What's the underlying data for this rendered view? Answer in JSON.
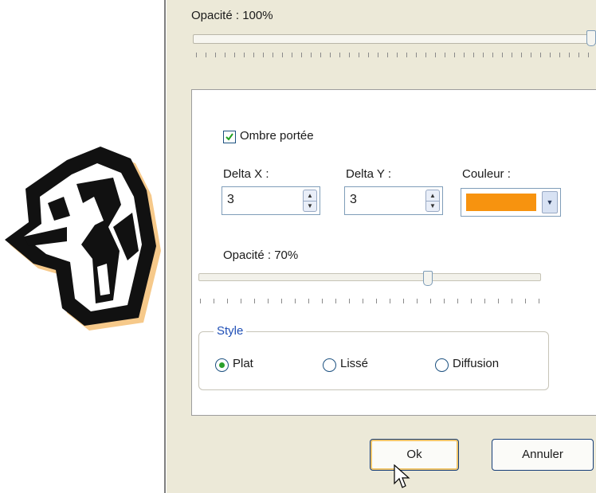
{
  "top": {
    "opacity_label": "Opacité : 100%",
    "opacity_value": 100
  },
  "shadow": {
    "checkbox_label": "Ombre portée",
    "checked": true,
    "delta_x_label": "Delta X :",
    "delta_x_value": "3",
    "delta_y_label": "Delta Y :",
    "delta_y_value": "3",
    "color_label": "Couleur :",
    "color_value": "#f7930f",
    "opacity_label": "Opacité : 70%",
    "opacity_value": 70
  },
  "style": {
    "legend": "Style",
    "options": [
      "Plat",
      "Lissé",
      "Diffusion"
    ],
    "selected": "Plat"
  },
  "buttons": {
    "ok": "Ok",
    "cancel": "Annuler"
  },
  "colors": {
    "dialog_bg": "#ece9d8",
    "accent_blue": "#1f4fb6",
    "radio_green": "#2aa02a",
    "shadow_color": "#f7930f"
  }
}
